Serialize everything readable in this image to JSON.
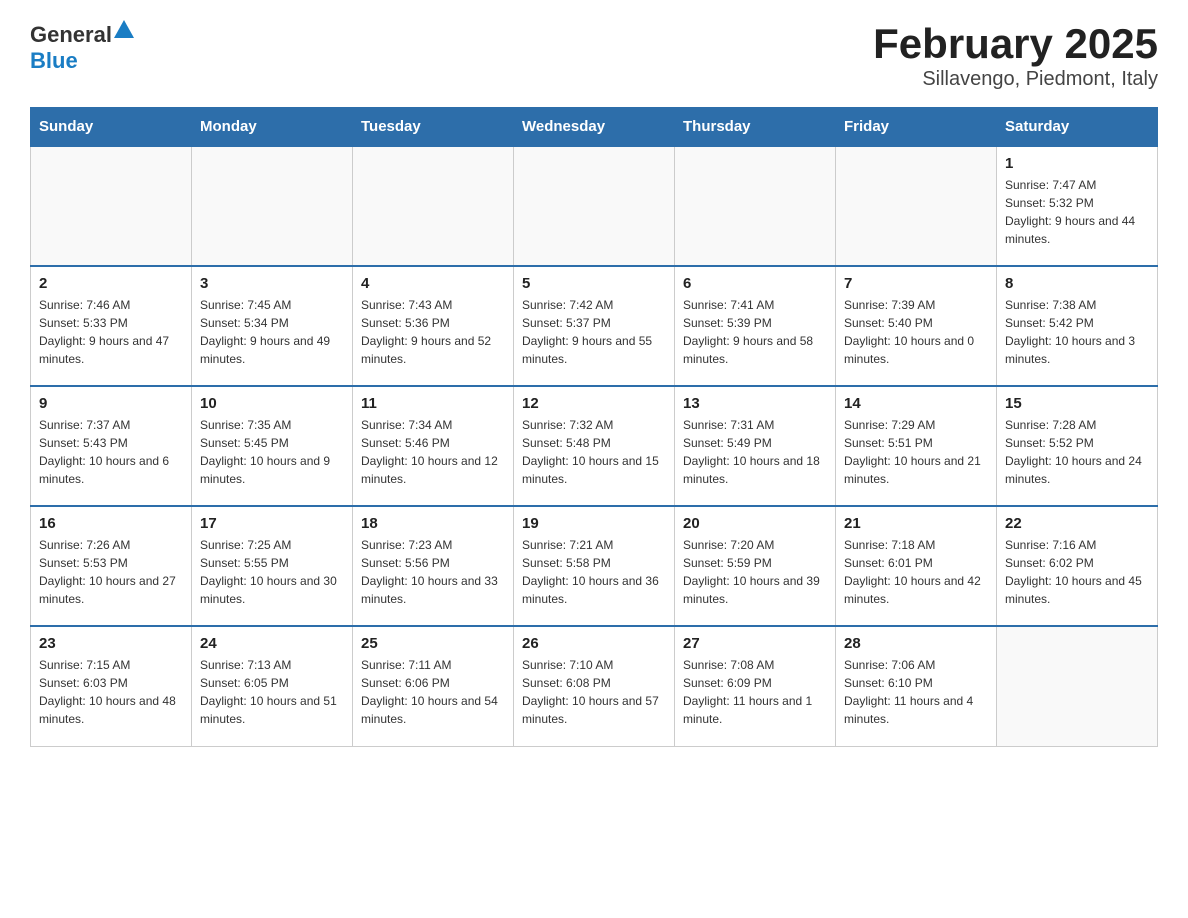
{
  "header": {
    "logo_general": "General",
    "logo_blue": "Blue",
    "title": "February 2025",
    "subtitle": "Sillavengo, Piedmont, Italy"
  },
  "days_of_week": [
    "Sunday",
    "Monday",
    "Tuesday",
    "Wednesday",
    "Thursday",
    "Friday",
    "Saturday"
  ],
  "weeks": [
    [
      {
        "day": "",
        "info": ""
      },
      {
        "day": "",
        "info": ""
      },
      {
        "day": "",
        "info": ""
      },
      {
        "day": "",
        "info": ""
      },
      {
        "day": "",
        "info": ""
      },
      {
        "day": "",
        "info": ""
      },
      {
        "day": "1",
        "info": "Sunrise: 7:47 AM\nSunset: 5:32 PM\nDaylight: 9 hours and 44 minutes."
      }
    ],
    [
      {
        "day": "2",
        "info": "Sunrise: 7:46 AM\nSunset: 5:33 PM\nDaylight: 9 hours and 47 minutes."
      },
      {
        "day": "3",
        "info": "Sunrise: 7:45 AM\nSunset: 5:34 PM\nDaylight: 9 hours and 49 minutes."
      },
      {
        "day": "4",
        "info": "Sunrise: 7:43 AM\nSunset: 5:36 PM\nDaylight: 9 hours and 52 minutes."
      },
      {
        "day": "5",
        "info": "Sunrise: 7:42 AM\nSunset: 5:37 PM\nDaylight: 9 hours and 55 minutes."
      },
      {
        "day": "6",
        "info": "Sunrise: 7:41 AM\nSunset: 5:39 PM\nDaylight: 9 hours and 58 minutes."
      },
      {
        "day": "7",
        "info": "Sunrise: 7:39 AM\nSunset: 5:40 PM\nDaylight: 10 hours and 0 minutes."
      },
      {
        "day": "8",
        "info": "Sunrise: 7:38 AM\nSunset: 5:42 PM\nDaylight: 10 hours and 3 minutes."
      }
    ],
    [
      {
        "day": "9",
        "info": "Sunrise: 7:37 AM\nSunset: 5:43 PM\nDaylight: 10 hours and 6 minutes."
      },
      {
        "day": "10",
        "info": "Sunrise: 7:35 AM\nSunset: 5:45 PM\nDaylight: 10 hours and 9 minutes."
      },
      {
        "day": "11",
        "info": "Sunrise: 7:34 AM\nSunset: 5:46 PM\nDaylight: 10 hours and 12 minutes."
      },
      {
        "day": "12",
        "info": "Sunrise: 7:32 AM\nSunset: 5:48 PM\nDaylight: 10 hours and 15 minutes."
      },
      {
        "day": "13",
        "info": "Sunrise: 7:31 AM\nSunset: 5:49 PM\nDaylight: 10 hours and 18 minutes."
      },
      {
        "day": "14",
        "info": "Sunrise: 7:29 AM\nSunset: 5:51 PM\nDaylight: 10 hours and 21 minutes."
      },
      {
        "day": "15",
        "info": "Sunrise: 7:28 AM\nSunset: 5:52 PM\nDaylight: 10 hours and 24 minutes."
      }
    ],
    [
      {
        "day": "16",
        "info": "Sunrise: 7:26 AM\nSunset: 5:53 PM\nDaylight: 10 hours and 27 minutes."
      },
      {
        "day": "17",
        "info": "Sunrise: 7:25 AM\nSunset: 5:55 PM\nDaylight: 10 hours and 30 minutes."
      },
      {
        "day": "18",
        "info": "Sunrise: 7:23 AM\nSunset: 5:56 PM\nDaylight: 10 hours and 33 minutes."
      },
      {
        "day": "19",
        "info": "Sunrise: 7:21 AM\nSunset: 5:58 PM\nDaylight: 10 hours and 36 minutes."
      },
      {
        "day": "20",
        "info": "Sunrise: 7:20 AM\nSunset: 5:59 PM\nDaylight: 10 hours and 39 minutes."
      },
      {
        "day": "21",
        "info": "Sunrise: 7:18 AM\nSunset: 6:01 PM\nDaylight: 10 hours and 42 minutes."
      },
      {
        "day": "22",
        "info": "Sunrise: 7:16 AM\nSunset: 6:02 PM\nDaylight: 10 hours and 45 minutes."
      }
    ],
    [
      {
        "day": "23",
        "info": "Sunrise: 7:15 AM\nSunset: 6:03 PM\nDaylight: 10 hours and 48 minutes."
      },
      {
        "day": "24",
        "info": "Sunrise: 7:13 AM\nSunset: 6:05 PM\nDaylight: 10 hours and 51 minutes."
      },
      {
        "day": "25",
        "info": "Sunrise: 7:11 AM\nSunset: 6:06 PM\nDaylight: 10 hours and 54 minutes."
      },
      {
        "day": "26",
        "info": "Sunrise: 7:10 AM\nSunset: 6:08 PM\nDaylight: 10 hours and 57 minutes."
      },
      {
        "day": "27",
        "info": "Sunrise: 7:08 AM\nSunset: 6:09 PM\nDaylight: 11 hours and 1 minute."
      },
      {
        "day": "28",
        "info": "Sunrise: 7:06 AM\nSunset: 6:10 PM\nDaylight: 11 hours and 4 minutes."
      },
      {
        "day": "",
        "info": ""
      }
    ]
  ]
}
